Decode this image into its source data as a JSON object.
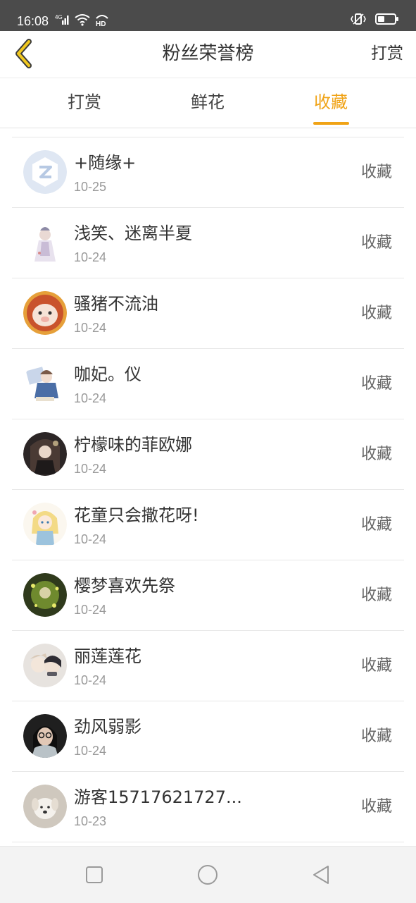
{
  "status_bar": {
    "time": "16:08",
    "network": "4G",
    "hd": "HD"
  },
  "header": {
    "title": "粉丝荣誉榜",
    "action_label": "打赏",
    "back_icon": "chevron-left-icon",
    "accent_color": "#f0a316"
  },
  "tabs": [
    {
      "label": "打赏",
      "active": false
    },
    {
      "label": "鲜花",
      "active": false
    },
    {
      "label": "收藏",
      "active": true
    }
  ],
  "fans": [
    {
      "name": "+随缘+",
      "date": "10-25",
      "action": "收藏"
    },
    {
      "name": "浅笑、迷离半夏",
      "date": "10-24",
      "action": "收藏"
    },
    {
      "name": "骚猪不流油",
      "date": "10-24",
      "action": "收藏"
    },
    {
      "name": "咖妃。仪",
      "date": "10-24",
      "action": "收藏"
    },
    {
      "name": "柠檬味的菲欧娜",
      "date": "10-24",
      "action": "收藏"
    },
    {
      "name": "花童只会撒花呀!",
      "date": "10-24",
      "action": "收藏"
    },
    {
      "name": "樱梦喜欢先祭",
      "date": "10-24",
      "action": "收藏"
    },
    {
      "name": "丽莲莲花",
      "date": "10-24",
      "action": "收藏"
    },
    {
      "name": "劲风弱影",
      "date": "10-24",
      "action": "收藏"
    },
    {
      "name": "游客15717621727...",
      "date": "10-23",
      "action": "收藏"
    }
  ],
  "nav_bar": {
    "recent_icon": "square-icon",
    "home_icon": "circle-icon",
    "back_icon": "triangle-back-icon"
  }
}
